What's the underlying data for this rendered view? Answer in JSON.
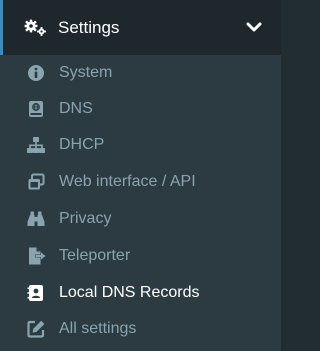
{
  "colors": {
    "sidebar_bg": "#2c3b41",
    "header_bg": "#1e282c",
    "accent_border": "#3c8dbc",
    "item_text": "#8aa4af",
    "active_text": "#ffffff"
  },
  "menu": {
    "title": "Settings",
    "icon": "gears-icon",
    "toggle_icon": "chevron-down-icon",
    "items": [
      {
        "label": "System",
        "icon": "info-circle-icon",
        "active": false
      },
      {
        "label": "DNS",
        "icon": "dns-book-icon",
        "active": false
      },
      {
        "label": "DHCP",
        "icon": "sitemap-icon",
        "active": false
      },
      {
        "label": "Web interface / API",
        "icon": "window-restore-icon",
        "active": false
      },
      {
        "label": "Privacy",
        "icon": "binoculars-icon",
        "active": false
      },
      {
        "label": "Teleporter",
        "icon": "file-export-icon",
        "active": false
      },
      {
        "label": "Local DNS Records",
        "icon": "address-card-icon",
        "active": true
      },
      {
        "label": "All settings",
        "icon": "edit-icon",
        "active": false
      }
    ]
  }
}
